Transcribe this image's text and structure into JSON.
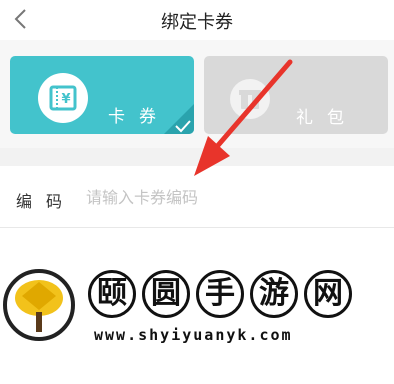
{
  "header": {
    "title": "绑定卡券",
    "back_icon": "chevron-left-icon"
  },
  "tabs": [
    {
      "label": "卡券",
      "icon": "coupon-icon",
      "selected": true
    },
    {
      "label": "礼包",
      "icon": "gift-icon",
      "selected": false
    }
  ],
  "form": {
    "code_label": "编码",
    "code_placeholder": "请输入卡券编码",
    "code_value": ""
  },
  "watermark": {
    "brand_chars": [
      "颐",
      "圆",
      "手",
      "游",
      "网"
    ],
    "url": "www.shyiyuanyk.com",
    "logo": "golden-tree-logo"
  },
  "colors": {
    "accent": "#43c3cc",
    "inactive": "#d9d9d9",
    "arrow": "#e8342b"
  }
}
